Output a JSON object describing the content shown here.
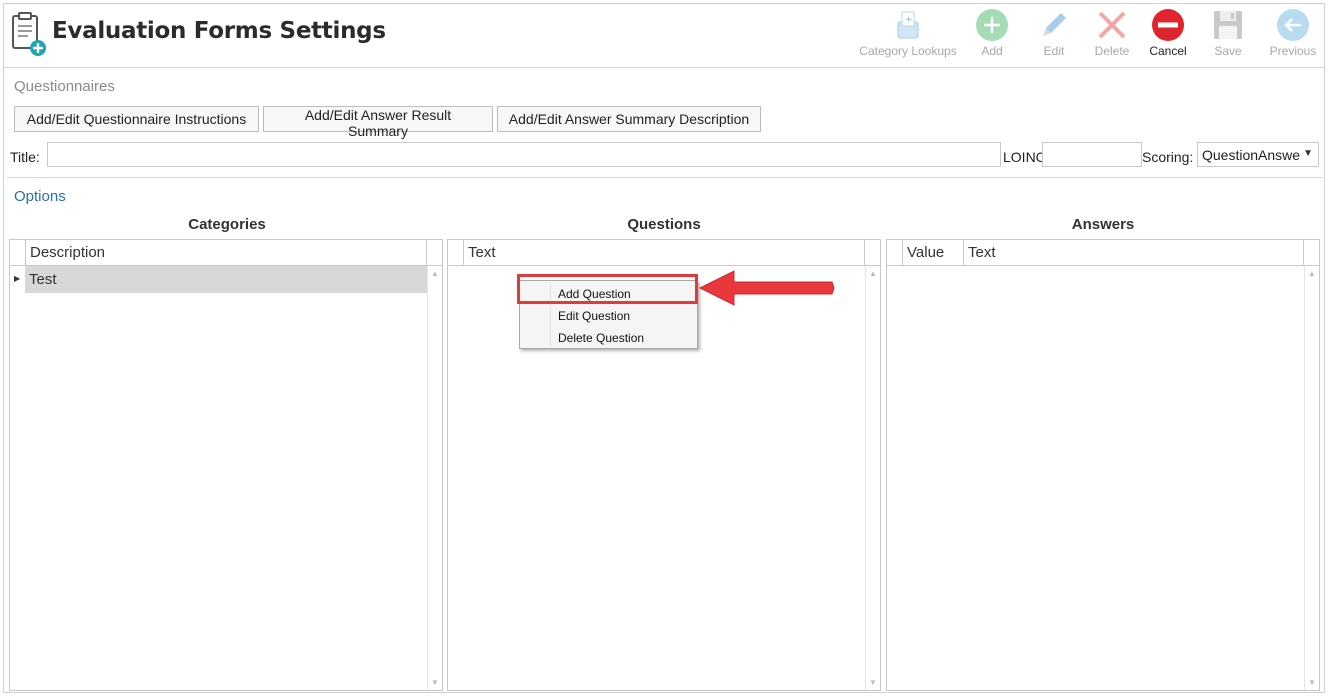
{
  "header": {
    "title": "Evaluation Forms Settings",
    "toolbar": [
      {
        "key": "category_lookups",
        "label": "Category Lookups",
        "icon": "category-lookups-icon",
        "enabled": false
      },
      {
        "key": "add",
        "label": "Add",
        "icon": "add-icon",
        "enabled": false
      },
      {
        "key": "edit",
        "label": "Edit",
        "icon": "edit-icon",
        "enabled": false
      },
      {
        "key": "delete",
        "label": "Delete",
        "icon": "delete-icon",
        "enabled": false
      },
      {
        "key": "cancel",
        "label": "Cancel",
        "icon": "cancel-icon",
        "enabled": true
      },
      {
        "key": "save",
        "label": "Save",
        "icon": "save-icon",
        "enabled": false
      },
      {
        "key": "previous",
        "label": "Previous",
        "icon": "previous-icon",
        "enabled": false
      }
    ]
  },
  "questionnaires": {
    "label": "Questionnaires",
    "buttons": {
      "instructions": "Add/Edit Questionnaire Instructions",
      "result_summary": "Add/Edit Answer Result Summary",
      "summary_description": "Add/Edit Answer Summary Description"
    },
    "title_label": "Title:",
    "title_value": "",
    "loinc_label": "LOINC",
    "loinc_value": "",
    "scoring_label": "Scoring:",
    "scoring_value": "QuestionAnswe"
  },
  "options": {
    "label": "Options",
    "categories": {
      "title": "Categories",
      "columns": [
        "Description"
      ],
      "rows": [
        "Test"
      ]
    },
    "questions": {
      "title": "Questions",
      "columns": [
        "Text"
      ]
    },
    "answers": {
      "title": "Answers",
      "columns": [
        "Value",
        "Text"
      ]
    }
  },
  "context_menu": {
    "items": [
      "Add Question",
      "Edit Question",
      "Delete Question"
    ]
  },
  "colors": {
    "accent_blue": "#2a6fb5",
    "highlight_red": "#e03a3a",
    "cancel_red": "#e0242e",
    "disabled_green": "#8fd4a0",
    "selected_row": "#d8d8d8"
  }
}
